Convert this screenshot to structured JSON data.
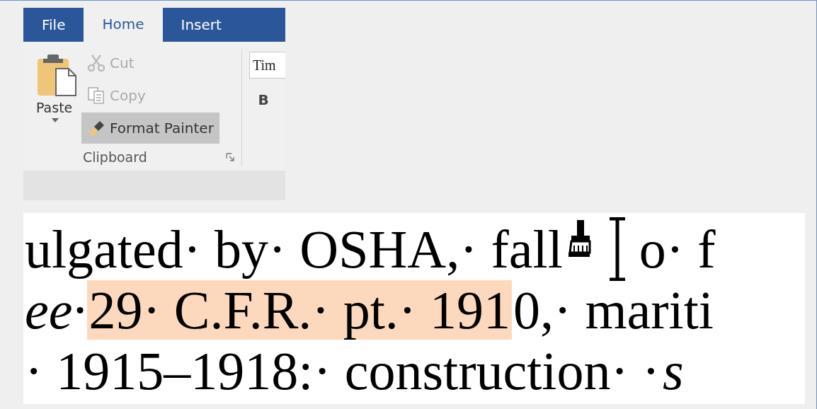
{
  "tabs": [
    {
      "label": "File",
      "selected": false
    },
    {
      "label": "Home",
      "selected": true
    },
    {
      "label": "Insert",
      "selected": false
    }
  ],
  "clipboard": {
    "paste": {
      "label": "Paste"
    },
    "items": [
      {
        "label": "Cut",
        "kind": "cut",
        "disabled": true,
        "active": false
      },
      {
        "label": "Copy",
        "kind": "copy",
        "disabled": true,
        "active": false
      },
      {
        "label": "Format Painter",
        "kind": "painter",
        "disabled": false,
        "active": true
      }
    ],
    "group_label": "Clipboard"
  },
  "font": {
    "value": "Tim",
    "bold_label": "B"
  },
  "document": {
    "lines": [
      {
        "segments": [
          {
            "kind": "text",
            "text": "ulgated· by· OSHA,· fall",
            "italic": false,
            "highlighted": false
          },
          {
            "kind": "cursor"
          },
          {
            "kind": "text",
            "text": "o· f",
            "italic": false,
            "highlighted": false
          }
        ]
      },
      {
        "segments": [
          {
            "kind": "text",
            "text": "ee·",
            "italic": true,
            "highlighted": false
          },
          {
            "kind": "text",
            "text": "29· C.F.R.· pt.· 191",
            "italic": false,
            "highlighted": true
          },
          {
            "kind": "text",
            "text": "0,· mariti",
            "italic": false,
            "highlighted": false
          }
        ]
      },
      {
        "segments": [
          {
            "kind": "text",
            "text": "· 1915–1918:· construction· ·",
            "italic": false,
            "highlighted": false
          },
          {
            "kind": "text",
            "text": "s",
            "italic": true,
            "highlighted": false
          }
        ]
      }
    ]
  }
}
